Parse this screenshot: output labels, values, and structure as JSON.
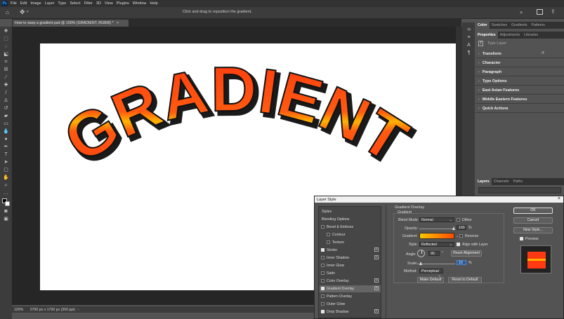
{
  "menu": {
    "app_icon": "Ps",
    "items": [
      "File",
      "Edit",
      "Image",
      "Layer",
      "Type",
      "Select",
      "Filter",
      "3D",
      "View",
      "Plugins",
      "Window",
      "Help"
    ]
  },
  "options_bar": {
    "hint": "Click and drag to reposition the gradient."
  },
  "document": {
    "tab_title": "How to warp a gradient.psd @ 100% (GRADIENT, RGB/8) *",
    "close": "×",
    "artwork_text": "GRADIENT"
  },
  "status": {
    "zoom": "100%",
    "info": "2700 px x 1700 px (300 ppi)"
  },
  "right_panel": {
    "top_tabs": [
      "Color",
      "Swatches",
      "Gradients",
      "Patterns"
    ],
    "prop_tabs": [
      "Properties",
      "Adjustments",
      "Libraries"
    ],
    "type_layer": "Type Layer",
    "sections": [
      "Transform",
      "Character",
      "Paragraph",
      "Type Options",
      "East Asian Features",
      "Middle Eastern Features",
      "Quick Actions"
    ],
    "layers_tabs": [
      "Layers",
      "Channels",
      "Paths"
    ]
  },
  "dialog": {
    "title": "Layer Style",
    "close": "×",
    "styles_header": "Styles",
    "style_items": [
      {
        "label": "Blending Options",
        "checkbox": false,
        "checked": false,
        "plus": false,
        "indent": false
      },
      {
        "label": "Bevel & Emboss",
        "checkbox": true,
        "checked": false,
        "plus": false,
        "indent": false
      },
      {
        "label": "Contour",
        "checkbox": true,
        "checked": false,
        "plus": false,
        "indent": true
      },
      {
        "label": "Texture",
        "checkbox": true,
        "checked": false,
        "plus": false,
        "indent": true
      },
      {
        "label": "Stroke",
        "checkbox": true,
        "checked": true,
        "plus": true,
        "indent": false
      },
      {
        "label": "Inner Shadow",
        "checkbox": true,
        "checked": false,
        "plus": true,
        "indent": false
      },
      {
        "label": "Inner Glow",
        "checkbox": true,
        "checked": false,
        "plus": false,
        "indent": false
      },
      {
        "label": "Satin",
        "checkbox": true,
        "checked": false,
        "plus": false,
        "indent": false
      },
      {
        "label": "Color Overlay",
        "checkbox": true,
        "checked": false,
        "plus": true,
        "indent": false
      },
      {
        "label": "Gradient Overlay",
        "checkbox": true,
        "checked": true,
        "plus": true,
        "indent": false,
        "active": true
      },
      {
        "label": "Pattern Overlay",
        "checkbox": true,
        "checked": false,
        "plus": false,
        "indent": false
      },
      {
        "label": "Outer Glow",
        "checkbox": true,
        "checked": false,
        "plus": false,
        "indent": false
      },
      {
        "label": "Drop Shadow",
        "checkbox": true,
        "checked": true,
        "plus": true,
        "indent": false
      }
    ],
    "section_title": "Gradient Overlay",
    "group_title": "Gradient",
    "blend_mode_label": "Blend Mode:",
    "blend_mode": "Normal",
    "dither_label": "Dither",
    "opacity_label": "Opacity:",
    "opacity": "100",
    "percent": "%",
    "gradient_label": "Gradient:",
    "reverse_label": "Reverse",
    "style_label": "Style:",
    "style_value": "Reflected",
    "align_label": "Align with Layer",
    "angle_label": "Angle:",
    "angle": "90",
    "degree": "°",
    "reset_alignment": "Reset Alignment",
    "scale_label": "Scale:",
    "scale": "10",
    "method_label": "Method:",
    "method": "Perceptual",
    "make_default": "Make Default",
    "reset_default": "Reset to Default",
    "ok": "OK",
    "cancel": "Cancel",
    "new_style": "New Style...",
    "preview_label": "Preview"
  }
}
